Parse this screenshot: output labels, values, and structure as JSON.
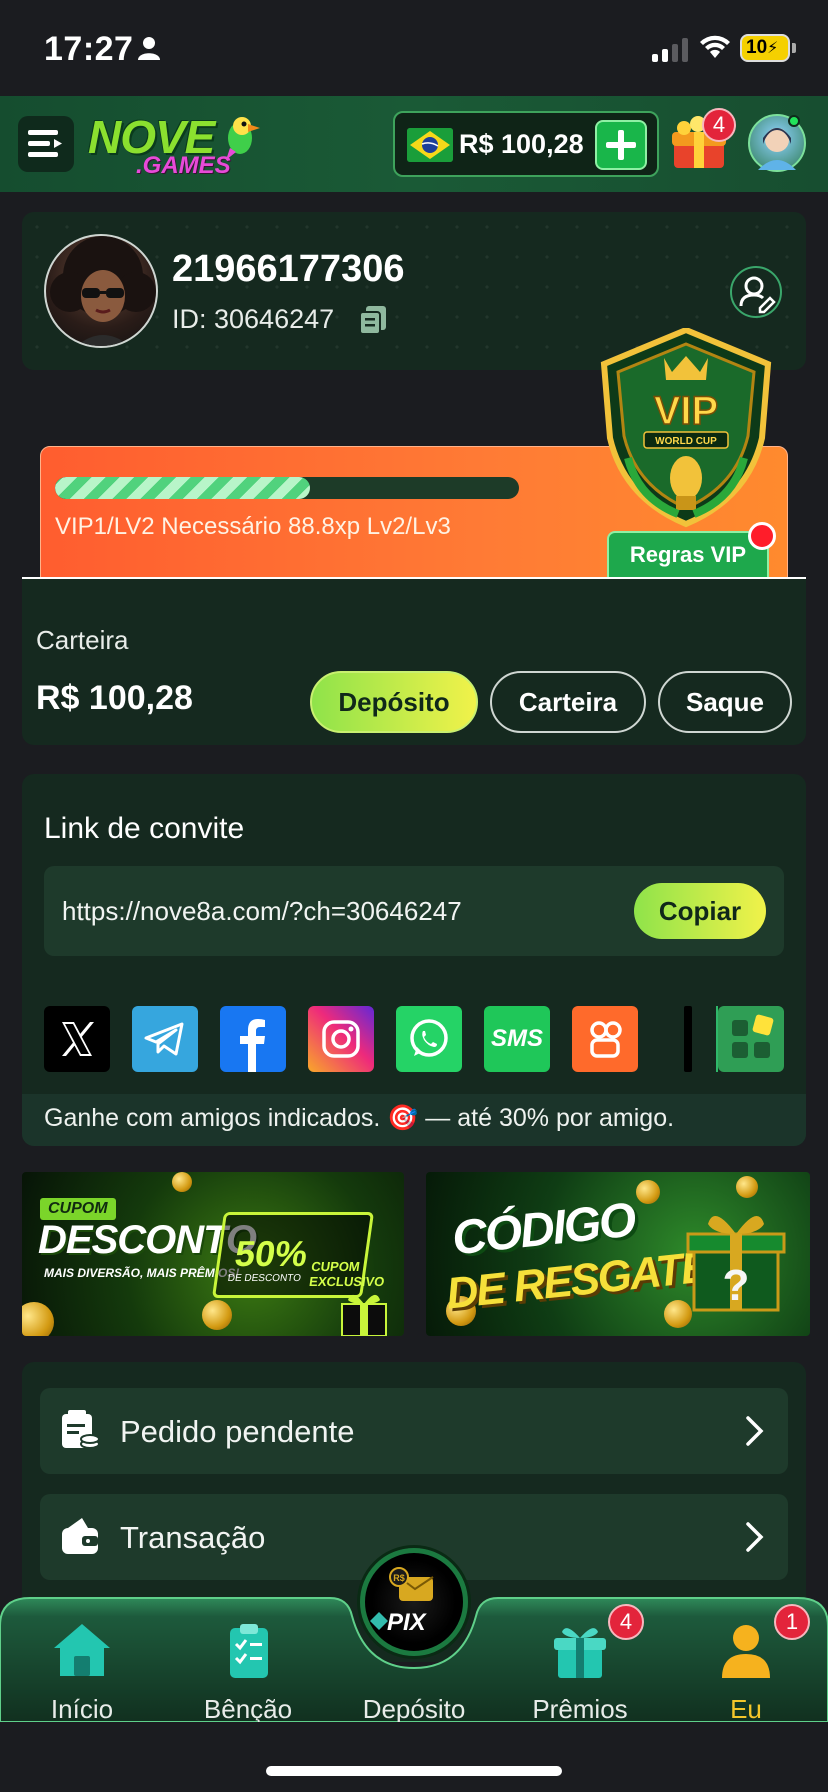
{
  "status_bar": {
    "time": "17:27",
    "battery": "10"
  },
  "header": {
    "logo_main": "NOVE",
    "logo_sub": ".GAMES",
    "balance": "R$ 100,28",
    "notification_count": "4"
  },
  "profile": {
    "username": "21966177306",
    "user_id": "ID: 30646247"
  },
  "vip": {
    "badge_title": "VIP",
    "badge_sub": "WORLD CUP",
    "progress_percent": 55,
    "progress_text": "VIP1/LV2 Necessário 88.8xp Lv2/Lv3",
    "rules_button": "Regras VIP"
  },
  "wallet": {
    "label": "Carteira",
    "value": "R$ 100,28",
    "deposit_button": "Depósito",
    "wallet_button": "Carteira",
    "withdraw_button": "Saque"
  },
  "invite": {
    "title": "Link de convite",
    "url": "https://nove8a.com/?ch=30646247",
    "copy_button": "Copiar",
    "share_sms_label": "SMS",
    "footer_text": "Ganhe com amigos indicados. 🎯 — até 30% por amigo."
  },
  "banners": {
    "left": {
      "tag": "CUPOM",
      "title": "DESCONTO",
      "subtitle": "MAIS DIVERSÃO, MAIS PRÊMIOS!",
      "percent": "50%",
      "percent_caption": "DE DESCONTO",
      "cupom_caption": "CUPOM EXCLUSIVO"
    },
    "right": {
      "line1": "CÓDIGO",
      "line2": "DE RESGATE"
    }
  },
  "menu": {
    "items": [
      {
        "label": "Pedido pendente"
      },
      {
        "label": "Transação"
      }
    ]
  },
  "bottom_nav": {
    "items": [
      {
        "label": "Início"
      },
      {
        "label": "Bênção"
      },
      {
        "label": "Depósito"
      },
      {
        "label": "Prêmios",
        "badge": "4"
      },
      {
        "label": "Eu",
        "badge": "1"
      }
    ],
    "pix_label": "PIX",
    "pix_currency": "R$"
  },
  "colors": {
    "accent_green": "#19b64a",
    "active_tab": "#f4c62a",
    "card_bg": "#15291f",
    "vip_orange": "#ff6a30"
  }
}
